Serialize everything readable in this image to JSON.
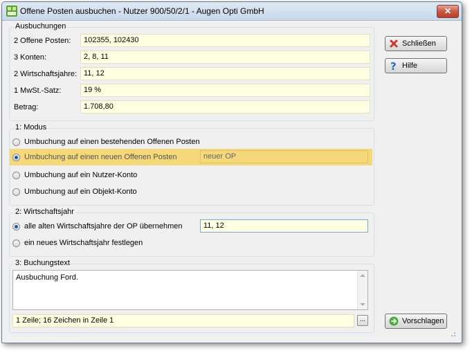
{
  "window": {
    "title": "Offene Posten ausbuchen - Nutzer 900/50/2/1 - Augen Opti GmbH",
    "close_symbol": "✕"
  },
  "ausbuchungen": {
    "title": "Ausbuchungen",
    "rows": [
      {
        "label": "2 Offene Posten:",
        "value": "102355,  102430"
      },
      {
        "label": "3 Konten:",
        "value": "2,  8,  11"
      },
      {
        "label": "2 Wirtschaftsjahre:",
        "value": "11,  12"
      },
      {
        "label": "1 MwSt.-Satz:",
        "value": "19 %"
      },
      {
        "label": "Betrag:",
        "value": "1.708,80"
      }
    ]
  },
  "modus": {
    "title": "1: Modus",
    "options": [
      {
        "label": "Umbuchung auf einen bestehenden Offenen Posten",
        "selected": false
      },
      {
        "label": "Umbuchung auf einen neuen Offenen Posten",
        "selected": true,
        "field_value": "neuer OP"
      },
      {
        "label": "Umbuchung auf ein Nutzer-Konto",
        "selected": false
      },
      {
        "label": "Umbuchung auf ein Objekt-Konto",
        "selected": false
      }
    ],
    "highlight_color": "#f5d87a"
  },
  "wirtschaftsjahr": {
    "title": "2: Wirtschaftsjahr",
    "options": [
      {
        "label": "alle alten Wirtschaftsjahre der OP übernehmen",
        "selected": true,
        "field_value": "11,  12"
      },
      {
        "label": "ein neues Wirtschaftsjahr festlegen",
        "selected": false
      }
    ]
  },
  "buchungstext": {
    "title": "3: Buchungstext",
    "text": "Ausbuchung Ford.",
    "status": "1 Zeile; 16 Zeichen in Zeile 1",
    "dots_label": "..."
  },
  "buttons": {
    "close": "Schließen",
    "help": "Hilfe",
    "suggest": "Vorschlagen"
  },
  "colors": {
    "field_bg": "#ffffe1",
    "accent": "#1e5a9a"
  }
}
